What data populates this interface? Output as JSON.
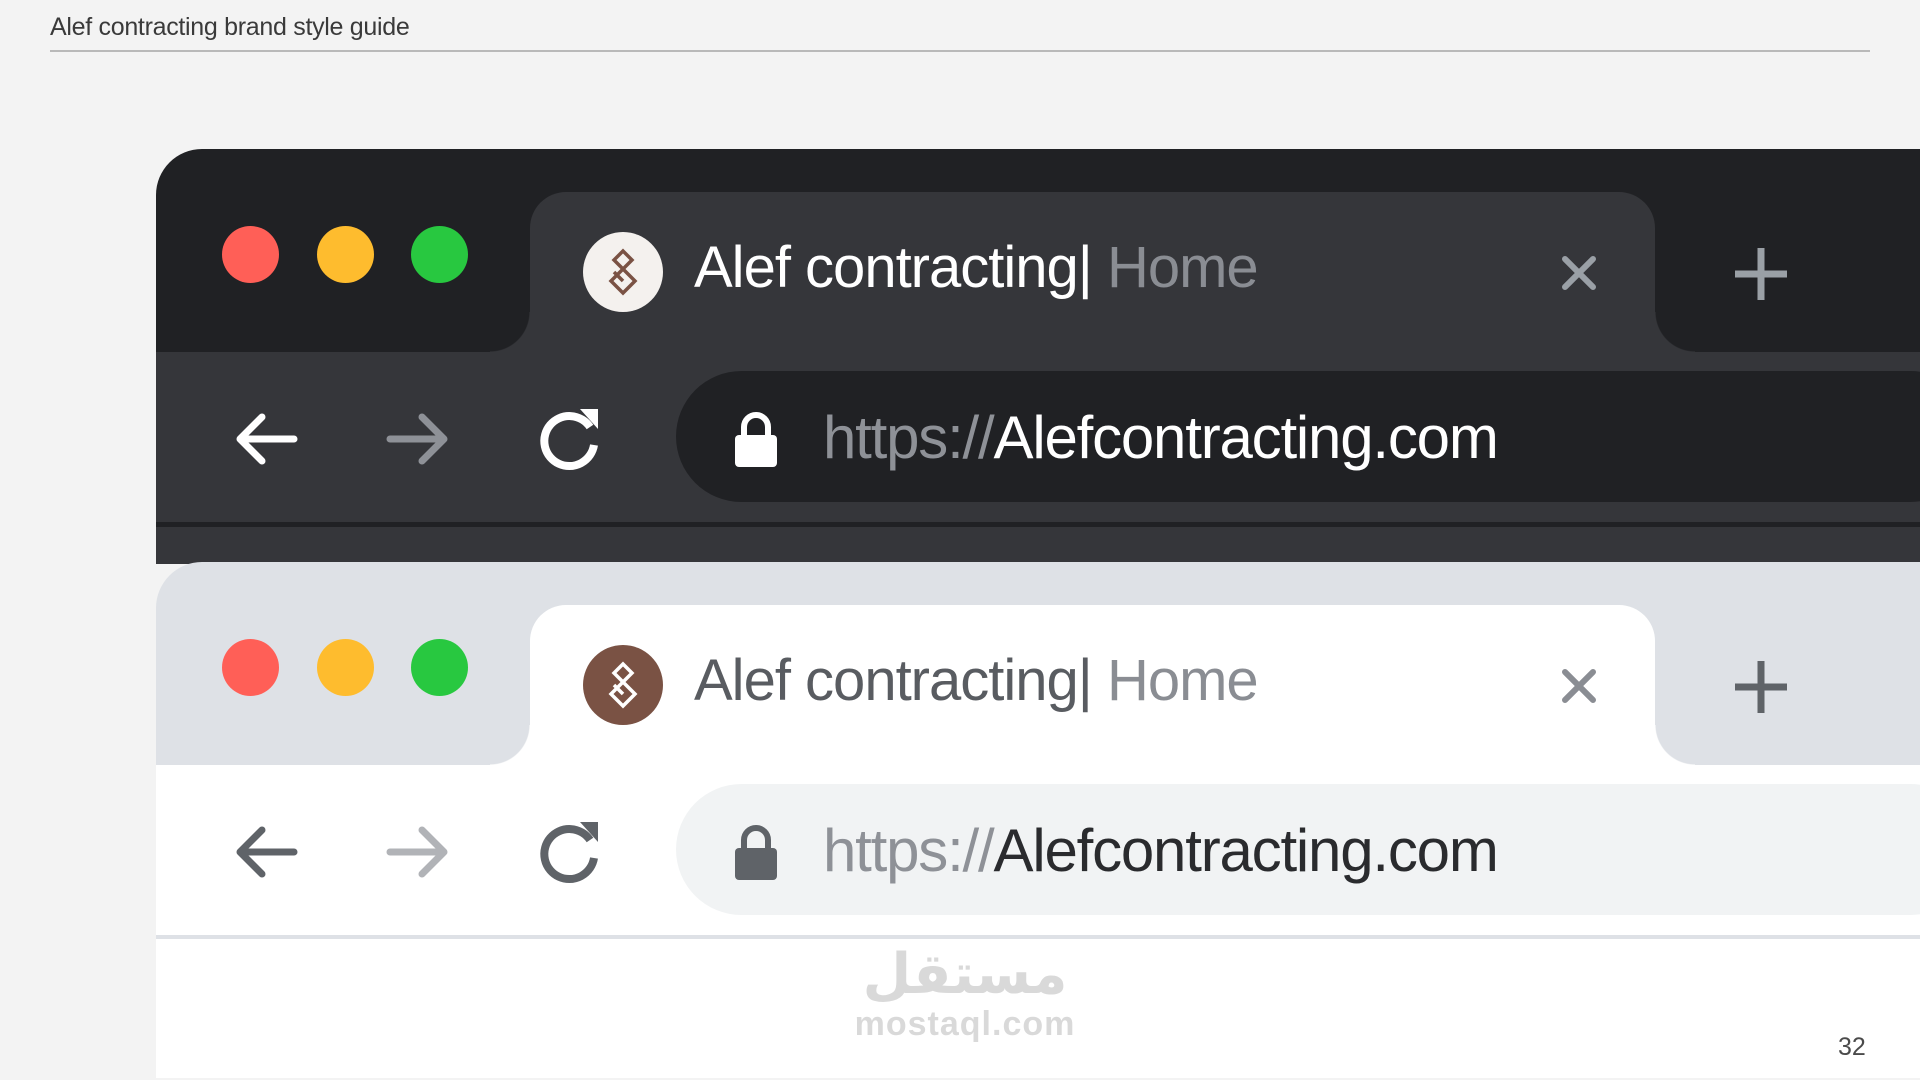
{
  "document": {
    "title": "Alef contracting brand style guide",
    "page_number": "32"
  },
  "browsers": {
    "dark": {
      "tab_site": "Alef contracting|",
      "tab_page": "Home",
      "url_scheme": "https://",
      "url_host": "Alefcontracting.com"
    },
    "light": {
      "tab_site": "Alef contracting|",
      "tab_page": "Home",
      "url_scheme": "https://",
      "url_host": "Alefcontracting.com"
    }
  },
  "watermark": {
    "arabic": "مستقل",
    "latin": "mostaql.com"
  },
  "colors": {
    "close": "#ff5f57",
    "minimize": "#febc2e",
    "maximize": "#28c840",
    "brand": "#7a5244"
  },
  "icons": [
    "back-arrow-icon",
    "forward-arrow-icon",
    "reload-icon",
    "lock-icon",
    "close-icon",
    "plus-icon",
    "alef-logo-icon"
  ]
}
